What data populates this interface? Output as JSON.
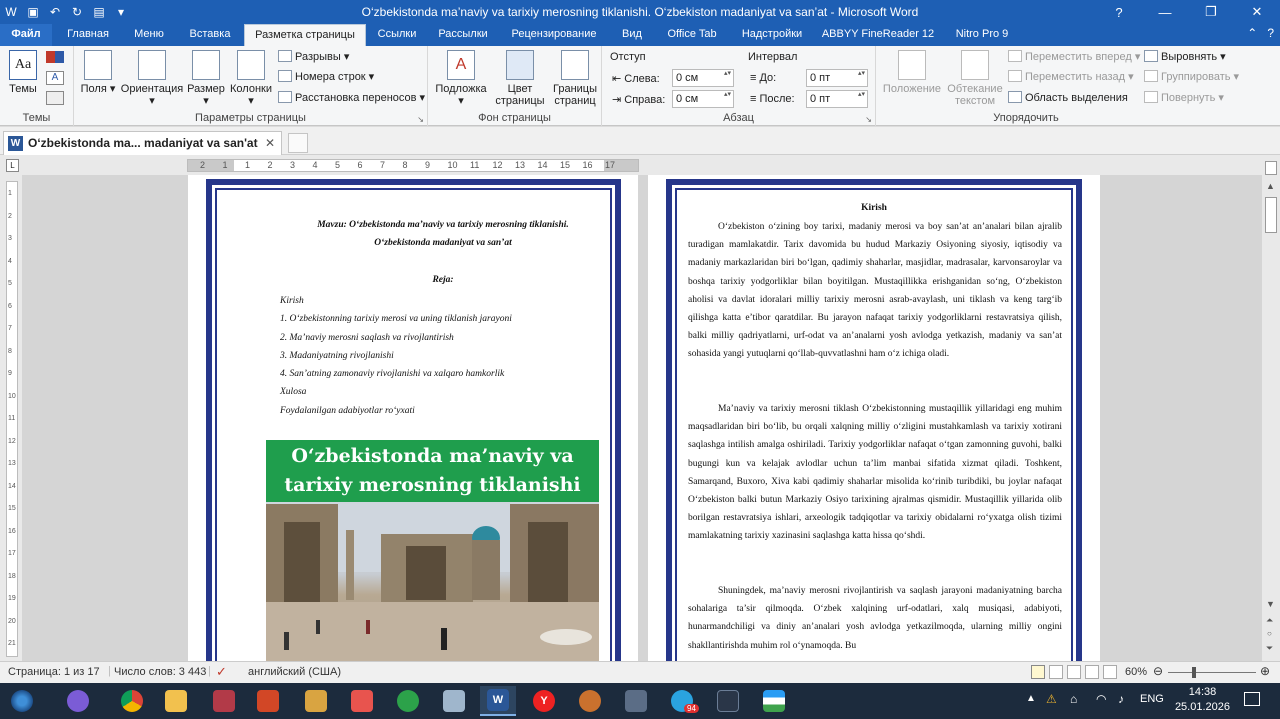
{
  "window": {
    "title": "O‘zbekistonda ma’naviy va tarixiy merosning tiklanishi. O‘zbekiston madaniyat va san’at  -  Microsoft Word"
  },
  "ribbon_tabs": [
    "Файл",
    "Главная",
    "Меню",
    "Вставка",
    "Разметка страницы",
    "Ссылки",
    "Рассылки",
    "Рецензирование",
    "Вид",
    "Office Tab",
    "Надстройки",
    "ABBYY FineReader 12",
    "Nitro Pro 9"
  ],
  "ribbon": {
    "themes": {
      "label": "Темы",
      "group": "Темы"
    },
    "page_setup": {
      "group": "Параметры страницы",
      "fields": "Поля",
      "orientation": "Ориентация",
      "size": "Размер",
      "columns": "Колонки",
      "breaks": "Разрывы",
      "line_numbers": "Номера строк",
      "hyphenation": "Расстановка переносов"
    },
    "page_background": {
      "group": "Фон страницы",
      "watermark": "Подложка",
      "page_color": "Цвет страницы",
      "page_borders": "Границы страниц"
    },
    "paragraph": {
      "group": "Абзац",
      "indent": "Отступ",
      "spacing": "Интервал",
      "left_label": "Слева:",
      "left_value": "0 см",
      "right_label": "Справа:",
      "right_value": "0 см",
      "before_label": "До:",
      "before_value": "0 пт",
      "after_label": "После:",
      "after_value": "0 пт"
    },
    "arrange": {
      "group": "Упорядочить",
      "position": "Положение",
      "wrap": "Обтекание текстом",
      "bring_forward": "Переместить вперед",
      "send_backward": "Переместить назад",
      "selection_pane": "Область выделения",
      "align": "Выровнять",
      "group_btn": "Группировать",
      "rotate": "Повернуть"
    }
  },
  "doc_tab": {
    "title": "O‘zbekistonda ma... madaniyat va san'at"
  },
  "ruler": {
    "marks": [
      "2",
      "1",
      "1",
      "2",
      "3",
      "4",
      "5",
      "6",
      "7",
      "8",
      "9",
      "10",
      "11",
      "12",
      "13",
      "14",
      "15",
      "16",
      "17"
    ]
  },
  "vruler": {
    "marks": [
      "1",
      "2",
      "3",
      "4",
      "5",
      "6",
      "7",
      "8",
      "9",
      "10",
      "11",
      "12",
      "13",
      "14",
      "15",
      "16",
      "17",
      "18",
      "19",
      "20",
      "21"
    ]
  },
  "page1": {
    "topic_line1": "Mavzu: O‘zbekistonda ma’naviy va tarixiy merosning tiklanishi.",
    "topic_line2": "O‘zbekistonda madaniyat va san’at",
    "plan_title": "Reja:",
    "plan": [
      "Kirish",
      "1. O‘zbekistonning tarixiy merosi va uning tiklanish jarayoni",
      "2. Ma’naviy merosni saqlash va rivojlantirish",
      "3. Madaniyatning rivojlanishi",
      "4. San’atning zamonaviy rivojlanishi va xalqaro hamkorlik",
      "Xulosa",
      "Foydalanilgan adabiyotlar ro‘yxati"
    ],
    "banner_line1": "O‘zbekistonda ma’naviy va",
    "banner_line2": "tarixiy merosning tiklanishi"
  },
  "page2": {
    "heading": "Kirish",
    "para1": "O‘zbekiston o‘zining boy tarixi, madaniy merosi va boy san’at an’analari bilan ajralib turadigan mamlakatdir. Tarix davomida bu hudud Markaziy Osiyoning siyosiy, iqtisodiy va madaniy markazlaridan biri bo‘lgan, qadimiy shaharlar, masjidlar, madrasalar, karvonsaroylar va boshqa tarixiy yodgorliklar bilan boyitilgan. Mustaqillikka erishganidan so‘ng, O‘zbekiston aholisi va davlat idoralari milliy tarixiy merosni asrab-avaylash, uni tiklash va keng targ‘ib qilishga katta e’tibor qaratdilar. Bu jarayon nafaqat tarixiy yodgorliklarni restavratsiya qilish, balki milliy qadriyatlarni, urf-odat va an’analarni yosh avlodga yetkazish, madaniy va san’at sohasida yangi yutuqlarni qo‘llab-quvvatlashni ham o‘z ichiga oladi.",
    "para2": "Ma’naviy va tarixiy merosni tiklash O‘zbekistonning mustaqillik yillaridagi eng muhim maqsadlaridan biri bo‘lib, bu orqali xalqning milliy o‘zligini mustahkamlash va tarixiy xotirani saqlashga intilish amalga oshiriladi. Tarixiy yodgorliklar nafaqat o‘tgan zamonning guvohi, balki bugungi kun va kelajak avlodlar uchun ta’lim manbai sifatida xizmat qiladi. Toshkent, Samarqand, Buxoro, Xiva kabi qadimiy shaharlar misolida ko‘rinib turibdiki, bu joylar nafaqat O‘zbekiston balki butun Markaziy Osiyo tarixining ajralmas qismidir. Mustaqillik yillarida olib borilgan restavratsiya ishlari, arxeologik tadqiqotlar va tarixiy obidalarni ro‘yxatga olish tizimi mamlakatning tarixiy xazinasini saqlashga katta hissa qo‘shdi.",
    "para3": "Shuningdek, ma’naviy merosni rivojlantirish va saqlash jarayoni madaniyatning barcha sohalariga ta’sir qilmoqda. O‘zbek xalqining urf-odatlari, xalq musiqasi, adabiyoti, hunarmandchiligi va diniy an’analari yosh avlodga yetkazilmoqda, ularning milliy ongini shakllantirishda muhim rol o‘ynamoqda. Bu"
  },
  "status": {
    "page": "Страница: 1 из 17",
    "words": "Число слов: 3 443",
    "language": "английский (США)",
    "zoom": "60%"
  },
  "taskbar": {
    "time": "14:38",
    "date": "25.01.2026",
    "lang": "ENG",
    "badge": "94"
  },
  "colors": {
    "title_bar": "#1e5fb4",
    "border": "#26368a",
    "banner": "#1f9e4d",
    "taskbar": "#1c2b3d"
  }
}
